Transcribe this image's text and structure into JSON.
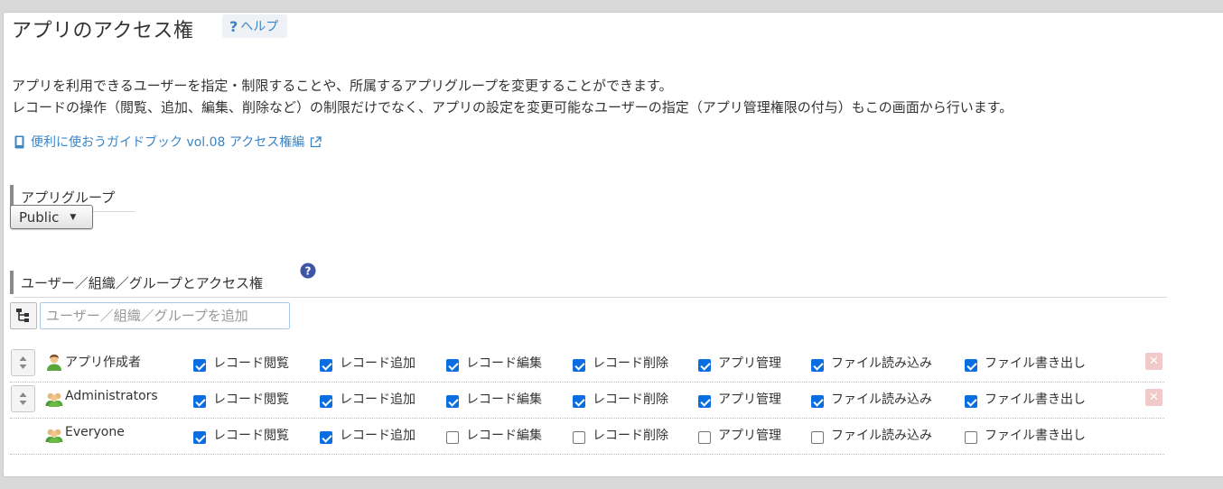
{
  "header": {
    "title": "アプリのアクセス権",
    "help_label": "ヘルプ",
    "help_mark": "?"
  },
  "description": {
    "line1": "アプリを利用できるユーザーを指定・制限することや、所属するアプリグループを変更することができます。",
    "line2": "レコードの操作（閲覧、追加、編集、削除など）の制限だけでなく、アプリの設定を変更可能なユーザーの指定（アプリ管理権限の付与）もこの画面から行います。"
  },
  "guide_link": {
    "label": "便利に使おうガイドブック vol.08 アクセス権編"
  },
  "app_group": {
    "heading": "アプリグループ",
    "selected": "Public"
  },
  "access": {
    "heading": "ユーザー／組織／グループとアクセス権",
    "add_placeholder": "ユーザー／組織／グループを追加",
    "permission_labels": [
      "レコード閲覧",
      "レコード追加",
      "レコード編集",
      "レコード削除",
      "アプリ管理",
      "ファイル読み込み",
      "ファイル書き出し"
    ],
    "rows": [
      {
        "name": "アプリ作成者",
        "icon": "user-icon",
        "perms": [
          true,
          true,
          true,
          true,
          true,
          true,
          true
        ],
        "sortable": true,
        "deletable": true
      },
      {
        "name": "Administrators",
        "icon": "group-icon",
        "perms": [
          true,
          true,
          true,
          true,
          true,
          true,
          true
        ],
        "sortable": true,
        "deletable": true
      },
      {
        "name": "Everyone",
        "icon": "group-icon",
        "perms": [
          true,
          true,
          false,
          false,
          false,
          false,
          false
        ],
        "sortable": false,
        "deletable": false
      }
    ]
  },
  "colors": {
    "link": "#3b85c4",
    "checkbox": "#0b6ee0",
    "delete": "#f2c9c9"
  }
}
